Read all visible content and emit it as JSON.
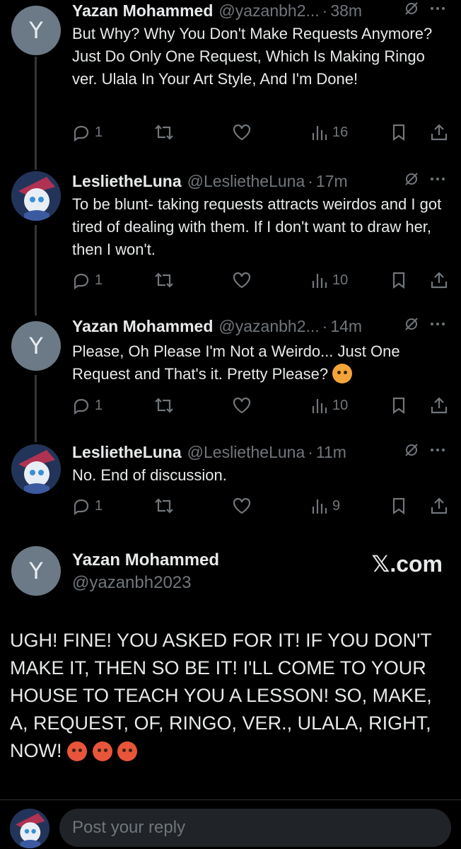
{
  "tweets": [
    {
      "name": "Yazan Mohammed",
      "handle": "@yazanbh2...",
      "time": "38m",
      "avatar_letter": "Y",
      "text": "But Why? Why You Don't Make Requests Anymore? Just Do Only One Request, Which Is Making Ringo ver. Ulala In Your Art Style, And I'm Done!",
      "replies": "1",
      "views": "16"
    },
    {
      "name": "LeslietheLuna",
      "handle": "@LeslietheLuna",
      "time": "17m",
      "text": "To be blunt- taking requests attracts weirdos and I got tired of dealing with them. If I don't want to draw her, then I won't.",
      "replies": "1",
      "views": "10"
    },
    {
      "name": "Yazan Mohammed",
      "handle": "@yazanbh2...",
      "time": "14m",
      "avatar_letter": "Y",
      "text": "Please, Oh Please I'm Not a Weirdo... Just One Request and That's it. Pretty Please?",
      "replies": "1",
      "views": "10"
    },
    {
      "name": "LeslietheLuna",
      "handle": "@LeslietheLuna",
      "time": "11m",
      "text": "No. End of discussion.",
      "replies": "1",
      "views": "9"
    }
  ],
  "main": {
    "avatar_letter": "Y",
    "name": "Yazan Mohammed",
    "handle": "@yazanbh2023",
    "brand": "𝕏.com",
    "text": "UGH! FINE! YOU ASKED FOR IT! IF YOU DON'T MAKE IT, THEN SO BE IT! I'LL COME TO YOUR HOUSE TO TEACH YOU A LESSON! SO, MAKE, A, REQUEST, OF, RINGO, VER., ULALA, RIGHT, NOW!"
  },
  "reply": {
    "placeholder": "Post your reply"
  },
  "separator": "·",
  "colors": {
    "background": "#000000",
    "text": "#e7e9ea",
    "muted": "#71767b",
    "avatar_y": "#6b7a86"
  }
}
